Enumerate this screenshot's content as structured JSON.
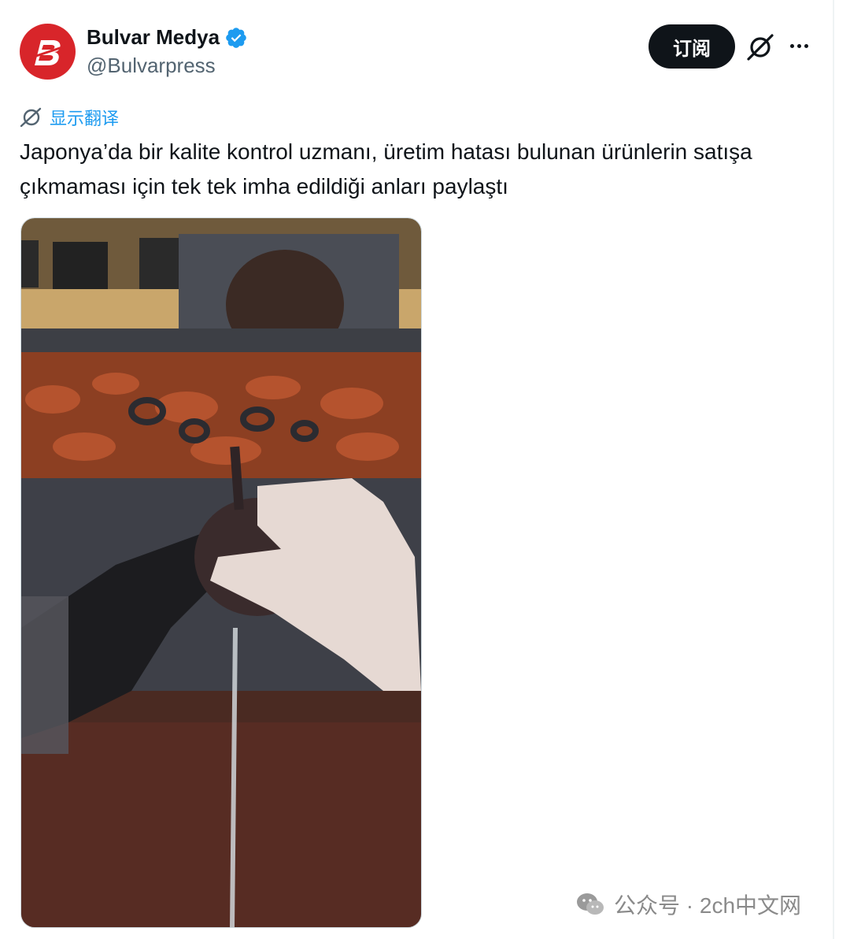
{
  "author": {
    "display_name": "Bulvar Medya",
    "handle": "@Bulvarpress",
    "avatar_letter": "B",
    "avatar_color": "#d8252a",
    "verified": true
  },
  "actions": {
    "subscribe_label": "订阅",
    "grok_icon": "grok-icon",
    "more_icon": "more-icon"
  },
  "translate": {
    "label": "显示翻译",
    "icon": "globe-icon"
  },
  "tweet": {
    "text": "Japonya’da bir kalite kontrol uzmanı, üretim hatası bulunan ürünlerin satışa çıkmaması için tek tek imha edildiği anları paylaştı"
  },
  "media": {
    "type": "video"
  },
  "watermark": {
    "text": "公众号 · 2ch中文网",
    "icon": "wechat-icon"
  },
  "colors": {
    "accent": "#1d9bf0",
    "text": "#0f1419",
    "secondary": "#536471",
    "button_bg": "#0f1419"
  }
}
